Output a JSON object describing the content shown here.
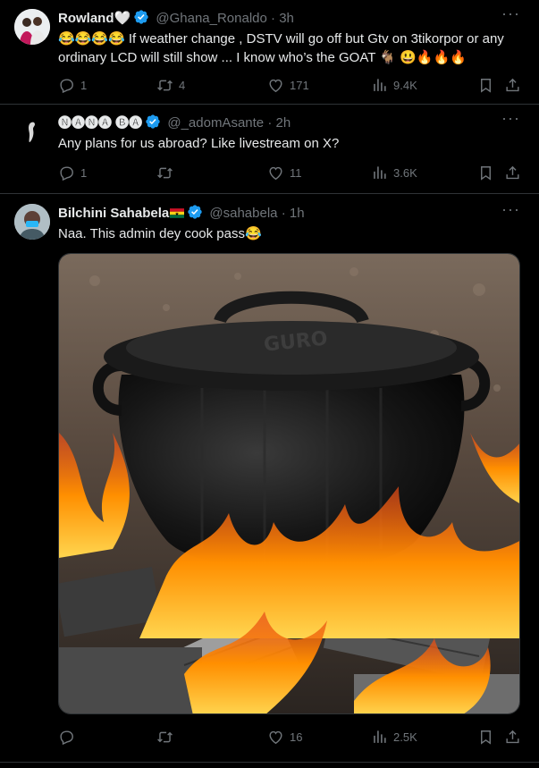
{
  "tweets": [
    {
      "name": "Rowland🤍",
      "handle": "@Ghana_Ronaldo",
      "dot": "·",
      "time": "3h",
      "text_line1": "😂😂😂😂 If weather change , DSTV will go off but Gtv on 3tikorpor or any",
      "text_line2": "ordinary LCD will still show ... I know who’s the GOAT 🐐 😃🔥🔥🔥",
      "replies": "1",
      "reposts": "4",
      "likes": "171",
      "views": "9.4K"
    },
    {
      "name": "🅝🅐🅝🅐 🅑🅐",
      "handle": "@_adomAsante",
      "dot": "·",
      "time": "2h",
      "text_line1": "Any plans for us abroad? Like livestream on X?",
      "replies": "1",
      "reposts": "",
      "likes": "11",
      "views": "3.6K"
    },
    {
      "name": "Bilchini Sahabela",
      "handle": "@sahabela",
      "dot": "·",
      "time": "1h",
      "text_line1": "Naa. This admin dey cook pass😂",
      "image_text": "GURO",
      "replies": "",
      "reposts": "",
      "likes": "16",
      "views": "2.5K"
    }
  ],
  "colors": {
    "background": "#000000",
    "text": "#e7e9ea",
    "muted": "#71767b",
    "verified": "#1d9bf0",
    "divider": "#2f3336"
  },
  "icons": [
    "reply-icon",
    "repost-icon",
    "like-icon",
    "views-icon",
    "bookmark-icon",
    "share-icon",
    "more-icon",
    "verified-icon"
  ]
}
